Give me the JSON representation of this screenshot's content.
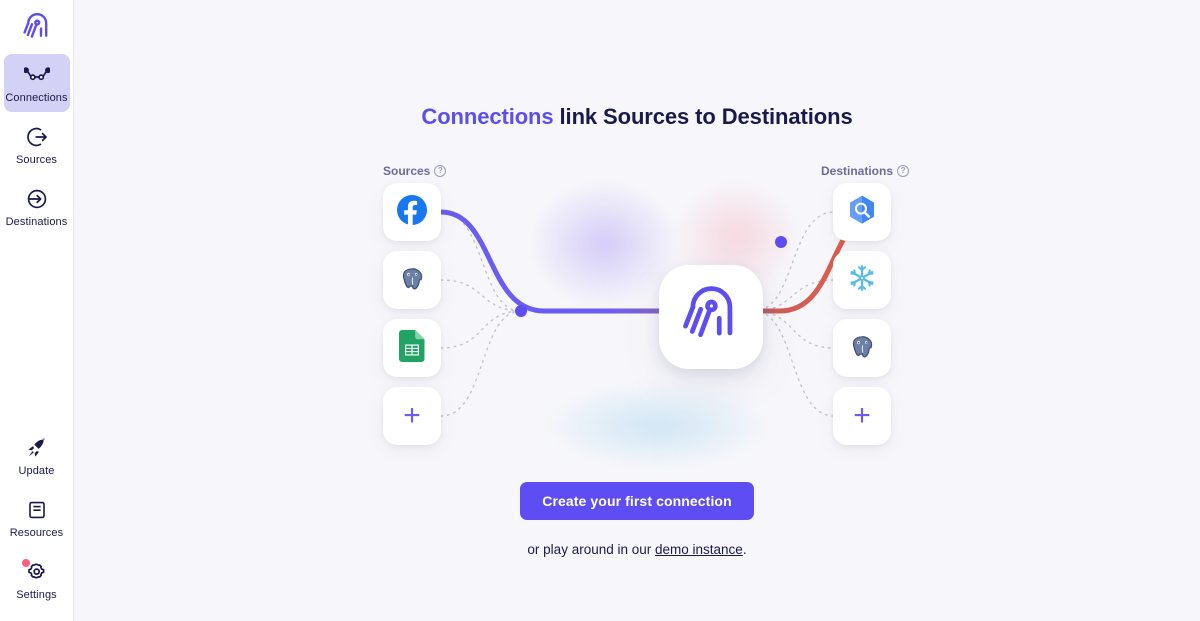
{
  "app": {
    "brand_icon": "airbyte-logo-icon",
    "accent_color": "#5c4df0",
    "background_color": "#f7f7fb"
  },
  "sidebar": {
    "top_items": [
      {
        "label": "Connections",
        "icon": "connections-icon",
        "active": true
      },
      {
        "label": "Sources",
        "icon": "sources-arrow-out-icon",
        "active": false
      },
      {
        "label": "Destinations",
        "icon": "destinations-arrow-in-icon",
        "active": false
      }
    ],
    "bottom_items": [
      {
        "label": "Update",
        "icon": "rocket-icon",
        "badge": false
      },
      {
        "label": "Resources",
        "icon": "book-icon",
        "badge": false
      },
      {
        "label": "Settings",
        "icon": "gear-icon",
        "badge": true,
        "badge_color": "#ff5f7a"
      }
    ]
  },
  "main": {
    "headline": {
      "accent_text": "Connections",
      "rest_text": " link Sources to Destinations"
    },
    "columns": {
      "sources_label": "Sources",
      "destinations_label": "Destinations",
      "help_glyph": "?"
    },
    "sources": [
      {
        "name": "facebook",
        "icon": "facebook-icon"
      },
      {
        "name": "postgres",
        "icon": "postgresql-elephant-icon"
      },
      {
        "name": "google-sheets",
        "icon": "google-sheets-icon"
      },
      {
        "name": "add-source",
        "icon": "plus-icon",
        "glyph": "+"
      }
    ],
    "destinations": [
      {
        "name": "bigquery",
        "icon": "bigquery-icon"
      },
      {
        "name": "snowflake",
        "icon": "snowflake-icon"
      },
      {
        "name": "postgres",
        "icon": "postgresql-elephant-icon"
      },
      {
        "name": "add-destination",
        "icon": "plus-icon",
        "glyph": "+"
      }
    ],
    "center_logo_icon": "airbyte-logo-icon",
    "wire_colors": {
      "source_wire": "#6b5cf6",
      "destination_wire": "#e05b4c",
      "dotted_wire": "#bfbfd0",
      "node_dot": "#5d4df2"
    },
    "cta": {
      "button_label": "Create your first connection",
      "sub_prefix": "or play around in our ",
      "sub_link": "demo instance",
      "sub_suffix": "."
    }
  }
}
